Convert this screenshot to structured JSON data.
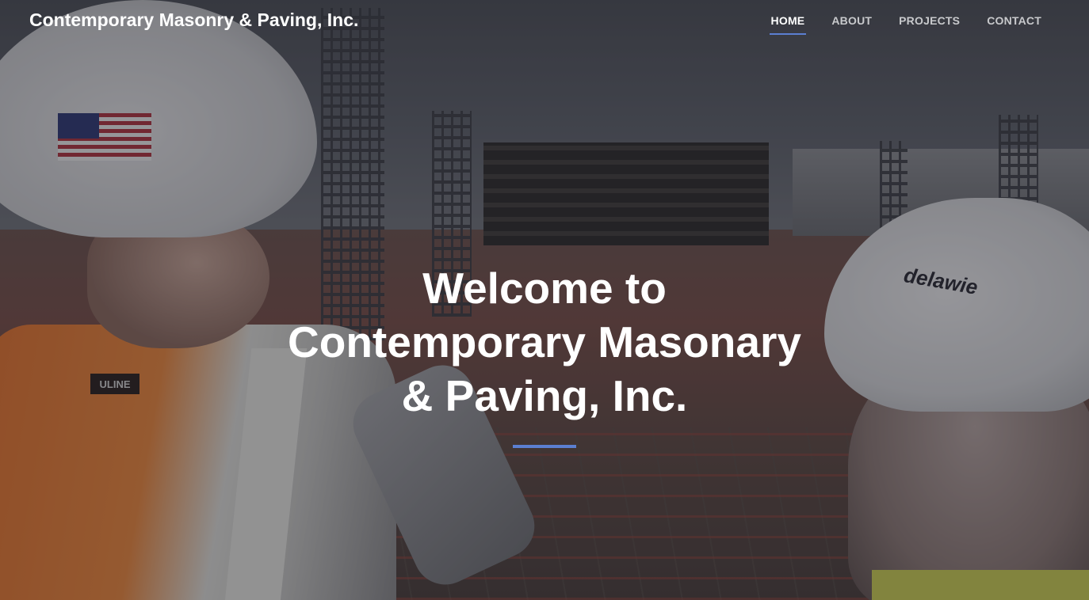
{
  "brand": {
    "name": "Contemporary Masonry & Paving, Inc."
  },
  "nav": {
    "items": [
      {
        "label": "HOME",
        "active": true
      },
      {
        "label": "ABOUT",
        "active": false
      },
      {
        "label": "PROJECTS",
        "active": false
      },
      {
        "label": "CONTACT",
        "active": false
      }
    ]
  },
  "hero": {
    "title_line1": "Welcome to",
    "title_line2": "Contemporary Masonary",
    "title_line3": "& Paving, Inc.",
    "photo_text": {
      "vest_label": "ULINE",
      "helmet_brand": "delawie"
    }
  },
  "colors": {
    "accent": "#5b7fd1",
    "nav_text": "#c8c9cc",
    "nav_active": "#ffffff"
  }
}
